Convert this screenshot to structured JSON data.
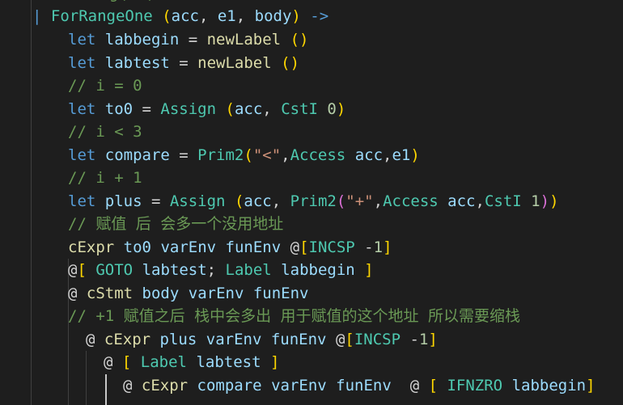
{
  "editor": {
    "lines": [
      {
        "tokens": [
          {
            "t": "//",
            "c": "com"
          },
          {
            "t": "  ",
            "c": "op"
          },
          {
            "t": "...",
            "c": "com"
          },
          {
            "t": "  ",
            "c": "op"
          },
          {
            "t": "g(",
            "c": "com"
          },
          {
            "t": "  ",
            "c": "op"
          },
          {
            "t": ")",
            "c": "com"
          }
        ]
      },
      {
        "tokens": [
          {
            "t": "| ",
            "c": "kw"
          },
          {
            "t": "ForRangeOne",
            "c": "ty"
          },
          {
            "t": " ",
            "c": "op"
          },
          {
            "t": "(",
            "c": "p1"
          },
          {
            "t": "acc",
            "c": "var"
          },
          {
            "t": ", ",
            "c": "op"
          },
          {
            "t": "e1",
            "c": "var"
          },
          {
            "t": ", ",
            "c": "op"
          },
          {
            "t": "body",
            "c": "var"
          },
          {
            "t": ")",
            "c": "p1"
          },
          {
            "t": " -> ",
            "c": "kw"
          }
        ]
      },
      {
        "tokens": [
          {
            "t": "let ",
            "c": "kw"
          },
          {
            "t": "labbegin",
            "c": "var"
          },
          {
            "t": " = ",
            "c": "op"
          },
          {
            "t": "newLabel",
            "c": "fn"
          },
          {
            "t": " ",
            "c": "op"
          },
          {
            "t": "()",
            "c": "p1"
          }
        ]
      },
      {
        "tokens": [
          {
            "t": "let ",
            "c": "kw"
          },
          {
            "t": "labtest",
            "c": "var"
          },
          {
            "t": " = ",
            "c": "op"
          },
          {
            "t": "newLabel",
            "c": "fn"
          },
          {
            "t": " ",
            "c": "op"
          },
          {
            "t": "()",
            "c": "p1"
          }
        ]
      },
      {
        "tokens": [
          {
            "t": "// i = 0",
            "c": "com"
          }
        ]
      },
      {
        "tokens": [
          {
            "t": "let ",
            "c": "kw"
          },
          {
            "t": "to0",
            "c": "var"
          },
          {
            "t": " = ",
            "c": "op"
          },
          {
            "t": "Assign",
            "c": "ty"
          },
          {
            "t": " ",
            "c": "op"
          },
          {
            "t": "(",
            "c": "p1"
          },
          {
            "t": "acc",
            "c": "var"
          },
          {
            "t": ", ",
            "c": "op"
          },
          {
            "t": "CstI",
            "c": "ty"
          },
          {
            "t": " ",
            "c": "op"
          },
          {
            "t": "0",
            "c": "num"
          },
          {
            "t": ")",
            "c": "p1"
          }
        ]
      },
      {
        "tokens": [
          {
            "t": "// i < 3",
            "c": "com"
          }
        ]
      },
      {
        "tokens": [
          {
            "t": "let ",
            "c": "kw"
          },
          {
            "t": "compare",
            "c": "var"
          },
          {
            "t": " = ",
            "c": "op"
          },
          {
            "t": "Prim2",
            "c": "ty"
          },
          {
            "t": "(",
            "c": "p1"
          },
          {
            "t": "\"<\"",
            "c": "str"
          },
          {
            "t": ",",
            "c": "op"
          },
          {
            "t": "Access",
            "c": "ty"
          },
          {
            "t": " ",
            "c": "op"
          },
          {
            "t": "acc",
            "c": "var"
          },
          {
            "t": ",",
            "c": "op"
          },
          {
            "t": "e1",
            "c": "var"
          },
          {
            "t": ")",
            "c": "p1"
          }
        ]
      },
      {
        "tokens": [
          {
            "t": "// i + 1",
            "c": "com"
          }
        ]
      },
      {
        "tokens": [
          {
            "t": "let ",
            "c": "kw"
          },
          {
            "t": "plus",
            "c": "var"
          },
          {
            "t": " = ",
            "c": "op"
          },
          {
            "t": "Assign",
            "c": "ty"
          },
          {
            "t": " ",
            "c": "op"
          },
          {
            "t": "(",
            "c": "p1"
          },
          {
            "t": "acc",
            "c": "var"
          },
          {
            "t": ", ",
            "c": "op"
          },
          {
            "t": "Prim2",
            "c": "ty"
          },
          {
            "t": "(",
            "c": "p2"
          },
          {
            "t": "\"+\"",
            "c": "str"
          },
          {
            "t": ",",
            "c": "op"
          },
          {
            "t": "Access",
            "c": "ty"
          },
          {
            "t": " ",
            "c": "op"
          },
          {
            "t": "acc",
            "c": "var"
          },
          {
            "t": ",",
            "c": "op"
          },
          {
            "t": "CstI",
            "c": "ty"
          },
          {
            "t": " ",
            "c": "op"
          },
          {
            "t": "1",
            "c": "num"
          },
          {
            "t": ")",
            "c": "p2"
          },
          {
            "t": ")",
            "c": "p1"
          }
        ]
      },
      {
        "tokens": [
          {
            "t": "// 赋值 后 会多一个没用地址",
            "c": "com"
          }
        ]
      },
      {
        "tokens": [
          {
            "t": "cExpr",
            "c": "fn"
          },
          {
            "t": " ",
            "c": "op"
          },
          {
            "t": "to0",
            "c": "var"
          },
          {
            "t": " ",
            "c": "op"
          },
          {
            "t": "varEnv",
            "c": "var"
          },
          {
            "t": " ",
            "c": "op"
          },
          {
            "t": "funEnv",
            "c": "var"
          },
          {
            "t": " @",
            "c": "op"
          },
          {
            "t": "[",
            "c": "p1"
          },
          {
            "t": "INCSP",
            "c": "ty"
          },
          {
            "t": " -",
            "c": "op"
          },
          {
            "t": "1",
            "c": "num"
          },
          {
            "t": "]",
            "c": "p1"
          }
        ]
      },
      {
        "tokens": [
          {
            "t": "@",
            "c": "op"
          },
          {
            "t": "[",
            "c": "p1"
          },
          {
            "t": " ",
            "c": "op"
          },
          {
            "t": "GOTO",
            "c": "ty"
          },
          {
            "t": " ",
            "c": "op"
          },
          {
            "t": "labtest",
            "c": "var"
          },
          {
            "t": "; ",
            "c": "op"
          },
          {
            "t": "Label",
            "c": "ty"
          },
          {
            "t": " ",
            "c": "op"
          },
          {
            "t": "labbegin",
            "c": "var"
          },
          {
            "t": " ",
            "c": "op"
          },
          {
            "t": "]",
            "c": "p1"
          }
        ]
      },
      {
        "tokens": [
          {
            "t": "@ ",
            "c": "op"
          },
          {
            "t": "cStmt",
            "c": "fn"
          },
          {
            "t": " ",
            "c": "op"
          },
          {
            "t": "body",
            "c": "var"
          },
          {
            "t": " ",
            "c": "op"
          },
          {
            "t": "varEnv",
            "c": "var"
          },
          {
            "t": " ",
            "c": "op"
          },
          {
            "t": "funEnv",
            "c": "var"
          }
        ]
      },
      {
        "tokens": [
          {
            "t": "// +1 赋值之后 栈中会多出 用于赋值的这个地址 所以需要缩栈",
            "c": "com"
          }
        ]
      },
      {
        "tokens": [
          {
            "t": "@ ",
            "c": "op"
          },
          {
            "t": "cExpr",
            "c": "fn"
          },
          {
            "t": " ",
            "c": "op"
          },
          {
            "t": "plus",
            "c": "var"
          },
          {
            "t": " ",
            "c": "op"
          },
          {
            "t": "varEnv",
            "c": "var"
          },
          {
            "t": " ",
            "c": "op"
          },
          {
            "t": "funEnv",
            "c": "var"
          },
          {
            "t": " @",
            "c": "op"
          },
          {
            "t": "[",
            "c": "p1"
          },
          {
            "t": "INCSP",
            "c": "ty"
          },
          {
            "t": " -",
            "c": "op"
          },
          {
            "t": "1",
            "c": "num"
          },
          {
            "t": "]",
            "c": "p1"
          }
        ]
      },
      {
        "tokens": [
          {
            "t": "@ ",
            "c": "op"
          },
          {
            "t": "[",
            "c": "p1"
          },
          {
            "t": " ",
            "c": "op"
          },
          {
            "t": "Label",
            "c": "ty"
          },
          {
            "t": " ",
            "c": "op"
          },
          {
            "t": "labtest",
            "c": "var"
          },
          {
            "t": " ",
            "c": "op"
          },
          {
            "t": "]",
            "c": "p1"
          }
        ]
      },
      {
        "tokens": [
          {
            "t": "@ ",
            "c": "op"
          },
          {
            "t": "cExpr",
            "c": "fn"
          },
          {
            "t": " ",
            "c": "op"
          },
          {
            "t": "compare",
            "c": "var"
          },
          {
            "t": " ",
            "c": "op"
          },
          {
            "t": "varEnv",
            "c": "var"
          },
          {
            "t": " ",
            "c": "op"
          },
          {
            "t": "funEnv",
            "c": "var"
          },
          {
            "t": "  @ ",
            "c": "op"
          },
          {
            "t": "[",
            "c": "p1"
          },
          {
            "t": " ",
            "c": "op"
          },
          {
            "t": "IFNZRO",
            "c": "ty"
          },
          {
            "t": " ",
            "c": "op"
          },
          {
            "t": "labbegin",
            "c": "var"
          },
          {
            "t": "]",
            "c": "p1"
          }
        ]
      }
    ]
  },
  "colors": {
    "background": "#1e1e1e",
    "keyword": "#569cd6",
    "variable": "#9cdcfe",
    "function": "#dcdcaa",
    "type": "#4ec9b0",
    "number": "#b5cea8",
    "string": "#ce9178",
    "comment": "#6a9955",
    "bracket1": "#ffd700",
    "bracket2": "#da70d6"
  }
}
